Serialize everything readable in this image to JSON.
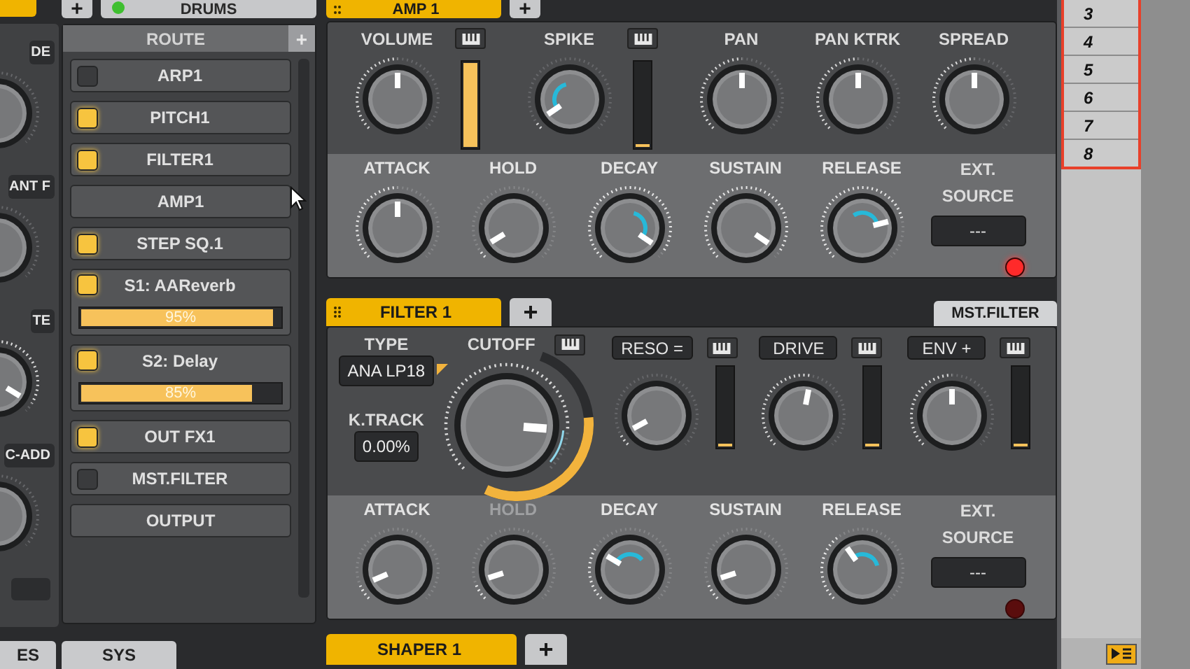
{
  "top_bar": {
    "add_button": "+",
    "instrument_tab": {
      "label": "DRUMS",
      "power_on": true
    }
  },
  "left_panel": {
    "sections": [
      {
        "field": "DE"
      },
      {
        "field": "ANT F"
      },
      {
        "field": "TE",
        "level": 0.95
      },
      {
        "field": "C-ADD"
      }
    ]
  },
  "route": {
    "title": "ROUTE",
    "add_button": "+",
    "items": [
      {
        "label": "ARP1",
        "kind": "toggle",
        "on": false
      },
      {
        "label": "PITCH1",
        "kind": "toggle",
        "on": true
      },
      {
        "label": "FILTER1",
        "kind": "toggle",
        "on": true
      },
      {
        "label": "AMP1",
        "kind": "plain"
      },
      {
        "label": "STEP SQ.1",
        "kind": "toggle",
        "on": true
      },
      {
        "label": "S1: AAReverb",
        "kind": "send",
        "on": true,
        "level": 0.95,
        "reading": "95%"
      },
      {
        "label": "S2: Delay",
        "kind": "send",
        "on": true,
        "level": 0.85,
        "reading": "85%"
      },
      {
        "label": "OUT FX1",
        "kind": "toggle",
        "on": true
      },
      {
        "label": "MST.FILTER",
        "kind": "toggle",
        "on": false
      },
      {
        "label": "OUTPUT",
        "kind": "plain"
      }
    ]
  },
  "bottom_tabs": [
    {
      "label": "ES"
    },
    {
      "label": "SYS"
    }
  ],
  "amp": {
    "tab": {
      "label": "AMP 1"
    },
    "add_button": "+",
    "controls": [
      {
        "label": "VOLUME",
        "level": 0.5,
        "modulated": false,
        "meter": {
          "level": 0.97
        }
      },
      {
        "label": "SPIKE",
        "level": 0.04,
        "modulated": true,
        "meter": {
          "level": 0.03
        }
      },
      {
        "label": "PAN",
        "level": 0.5,
        "modulated": false
      },
      {
        "label": "PAN KTRK",
        "level": 0.5,
        "modulated": false
      },
      {
        "label": "SPREAD",
        "level": 0.5,
        "modulated": false
      }
    ],
    "envelope": [
      {
        "label": "ATTACK",
        "level": 0.5,
        "modulated": false,
        "disabled": false
      },
      {
        "label": "HOLD",
        "level": 0.05,
        "modulated": false,
        "disabled": false
      },
      {
        "label": "DECAY",
        "level": 0.96,
        "modulated": true,
        "disabled": false
      },
      {
        "label": "SUSTAIN",
        "level": 0.96,
        "modulated": false,
        "disabled": false
      },
      {
        "label": "RELEASE",
        "level": 0.78,
        "modulated": true,
        "disabled": false
      }
    ],
    "ext_source": {
      "label": "EXT. SOURCE",
      "value": "---",
      "led_on": true
    }
  },
  "filter": {
    "tab": {
      "label": "FILTER 1"
    },
    "add_button": "+",
    "master_button": "MST.FILTER",
    "type": {
      "label": "TYPE",
      "value": "ANA LP18"
    },
    "keytrack": {
      "label": "K.TRACK",
      "value": "0.00%"
    },
    "cutoff": {
      "label": "CUTOFF",
      "level": 0.85,
      "modulated": true,
      "mod": {
        "level": 0.65
      }
    },
    "knobs": [
      {
        "label": "RESO =",
        "level": 0.06,
        "modulated": false,
        "meter": {
          "level": 0.03
        }
      },
      {
        "label": "DRIVE",
        "level": 0.54,
        "modulated": false,
        "meter": {
          "level": 0.03
        }
      },
      {
        "label": "ENV +",
        "level": 0.5,
        "modulated": false,
        "meter": {
          "level": 0.03
        }
      }
    ],
    "envelope": [
      {
        "label": "ATTACK",
        "level": 0.08,
        "modulated": false,
        "disabled": false
      },
      {
        "label": "HOLD",
        "level": 0.1,
        "modulated": false,
        "disabled": true
      },
      {
        "label": "DECAY",
        "level": 0.28,
        "modulated": true,
        "disabled": false
      },
      {
        "label": "SUSTAIN",
        "level": 0.1,
        "modulated": false,
        "disabled": false
      },
      {
        "label": "RELEASE",
        "level": 0.37,
        "modulated": true,
        "disabled": false
      }
    ],
    "ext_source": {
      "label": "EXT. SOURCE",
      "value": "---",
      "led_on": false
    }
  },
  "shaper": {
    "tab": {
      "label": "SHAPER 1"
    },
    "add_button": "+"
  },
  "clip_slots": [
    "3",
    "4",
    "5",
    "6",
    "7",
    "8"
  ]
}
